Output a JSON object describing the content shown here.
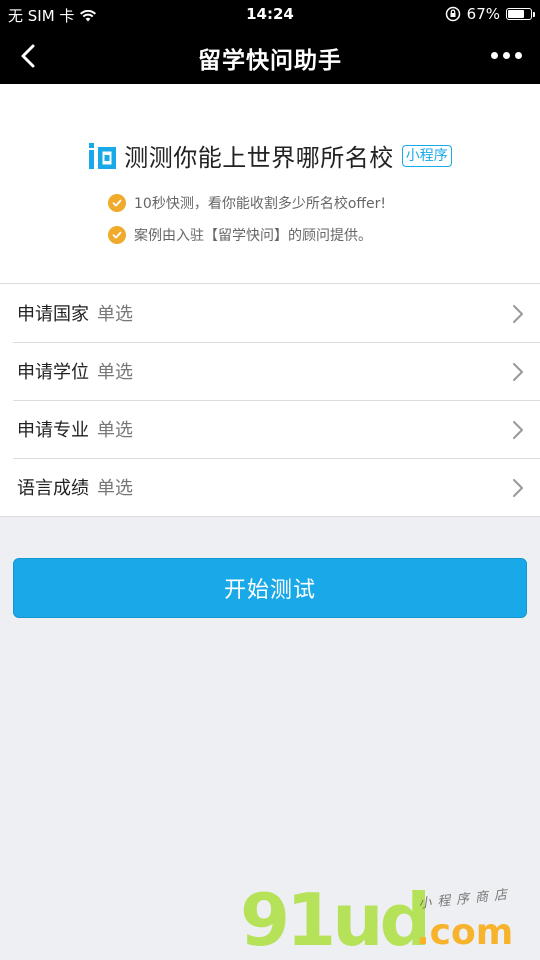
{
  "status_bar": {
    "carrier": "无 SIM 卡",
    "time": "14:24",
    "battery": "67%",
    "battery_level": 0.67
  },
  "nav": {
    "title": "留学快问助手"
  },
  "header": {
    "brand_text": "测测你能上世界哪所名校",
    "badge": "小程序",
    "bullets": [
      "10秒快测，看你能收割多少所名校offer!",
      "案例由入驻【留学快问】的顾问提供。"
    ]
  },
  "form": {
    "rows": [
      {
        "label": "申请国家",
        "value": "单选"
      },
      {
        "label": "申请学位",
        "value": "单选"
      },
      {
        "label": "申请专业",
        "value": "单选"
      },
      {
        "label": "语言成绩",
        "value": "单选"
      }
    ]
  },
  "start_button": "开始测试",
  "watermark": {
    "main": "91ud",
    "com": ".com",
    "sub": "小程序商店"
  },
  "colors": {
    "accent": "#1aa9e8",
    "check": "#f0aa2c",
    "background": "#eeeff3"
  }
}
